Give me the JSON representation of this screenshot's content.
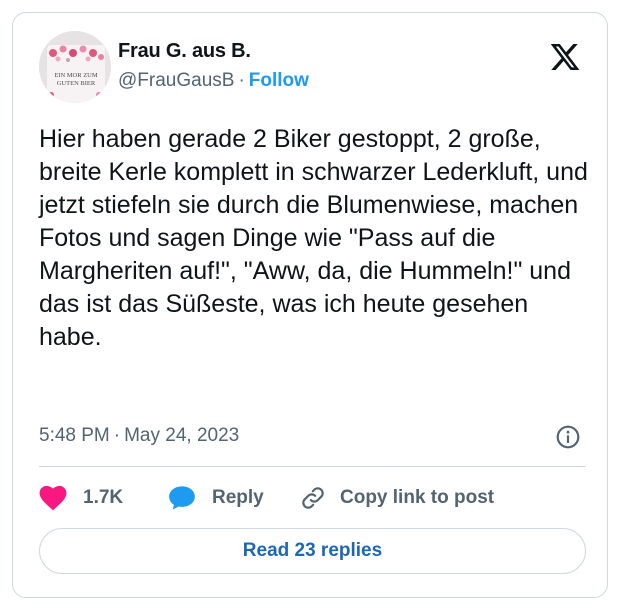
{
  "author": {
    "name": "Frau G. aus B.",
    "handle": "@FrauGausB",
    "separator": "·",
    "follow_label": "Follow",
    "avatar_mug_text": [
      "EIN MOR ZUM",
      "GUTEN BIER"
    ]
  },
  "tweet": {
    "text": "Hier haben gerade 2 Biker gestoppt, 2 große, breite Kerle komplett in schwarzer Lederkluft, und jetzt stiefeln sie durch die Blumenwiese, machen Fotos und sagen Dinge wie \"Pass auf die Margheriten auf!\", \"Aww, da, die Hummeln!\" und das ist das Süßeste, was ich heute gesehen habe.",
    "time": "5:48 PM",
    "separator": "·",
    "date": "May 24, 2023"
  },
  "actions": {
    "like_count": "1.7K",
    "reply_label": "Reply",
    "copy_link_label": "Copy link to post",
    "read_replies_label": "Read 23 replies"
  },
  "colors": {
    "accent": "#1d9bf0",
    "like": "#f91880",
    "reply_bubble": "#1d9bf0",
    "muted": "#536471",
    "border": "#cfd9de"
  },
  "icons": {
    "brand": "x-logo-icon",
    "info": "info-icon",
    "like": "heart-icon",
    "reply": "speech-bubble-icon",
    "copy": "link-icon"
  }
}
